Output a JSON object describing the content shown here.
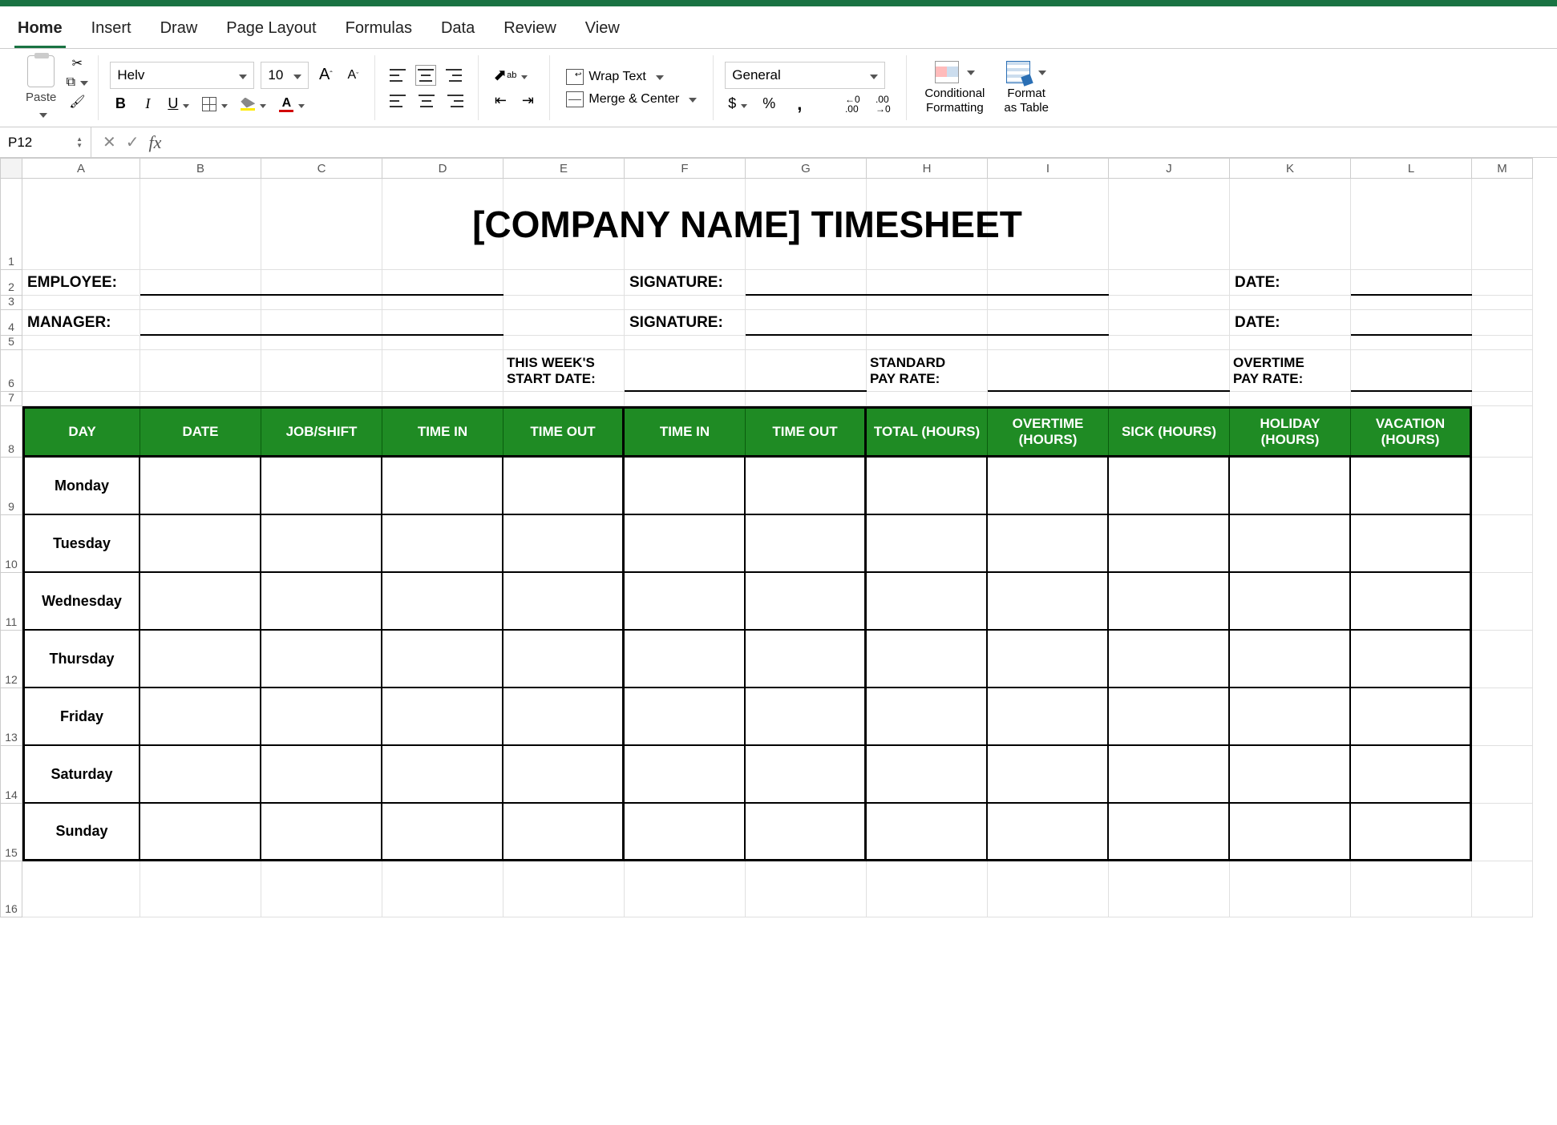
{
  "tabs": [
    "Home",
    "Insert",
    "Draw",
    "Page Layout",
    "Formulas",
    "Data",
    "Review",
    "View"
  ],
  "activeTab": "Home",
  "ribbon": {
    "paste": "Paste",
    "font_name": "Helv",
    "font_size": "10",
    "wrap": "Wrap Text",
    "merge": "Merge & Center",
    "number_format": "General",
    "cond_fmt": "Conditional\nFormatting",
    "fmt_table": "Format\nas Table"
  },
  "namebox": "P12",
  "formula": "",
  "columns": [
    "A",
    "B",
    "C",
    "D",
    "E",
    "F",
    "G",
    "H",
    "I",
    "J",
    "K",
    "L",
    "M"
  ],
  "rows": [
    "1",
    "2",
    "3",
    "4",
    "5",
    "6",
    "7",
    "8",
    "9",
    "10",
    "11",
    "12",
    "13",
    "14",
    "15",
    "16"
  ],
  "sheet": {
    "title": "[COMPANY NAME] TIMESHEET",
    "employee": "EMPLOYEE:",
    "manager": "MANAGER:",
    "signature": "SIGNATURE:",
    "date": "DATE:",
    "week_start_l1": "THIS WEEK'S",
    "week_start_l2": "START DATE:",
    "std_rate_l1": "STANDARD",
    "std_rate_l2": "PAY RATE:",
    "ot_rate_l1": "OVERTIME",
    "ot_rate_l2": "PAY RATE:",
    "headers": [
      "DAY",
      "DATE",
      "JOB/SHIFT",
      "TIME IN",
      "TIME OUT",
      "TIME IN",
      "TIME OUT",
      "TOTAL (HOURS)",
      "OVERTIME (HOURS)",
      "SICK (HOURS)",
      "HOLIDAY (HOURS)",
      "VACATION (HOURS)"
    ],
    "days": [
      "Monday",
      "Tuesday",
      "Wednesday",
      "Thursday",
      "Friday",
      "Saturday",
      "Sunday"
    ]
  }
}
